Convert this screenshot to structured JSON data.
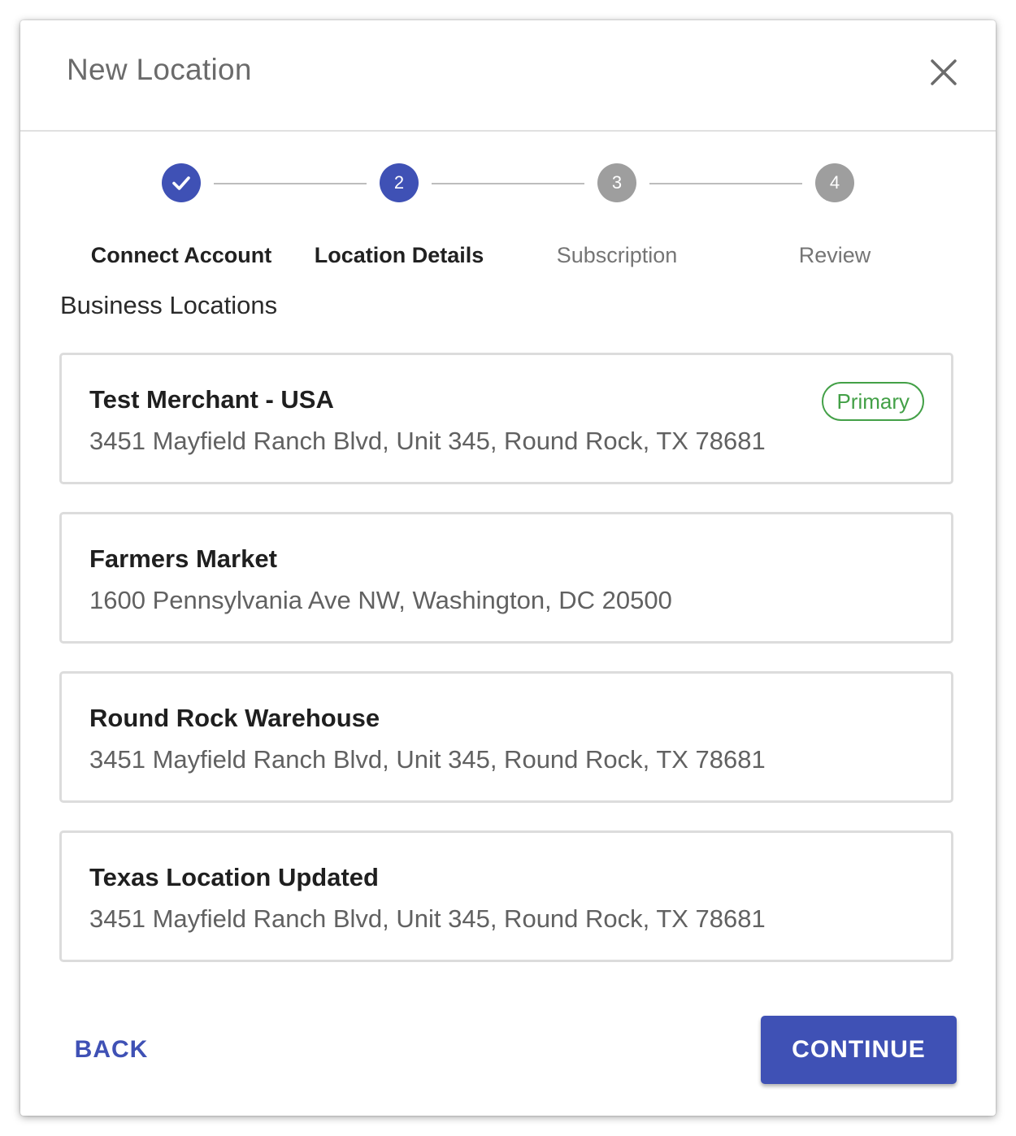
{
  "dialog": {
    "title": "New Location",
    "close_icon": "close-icon"
  },
  "stepper": {
    "steps": [
      {
        "number": "",
        "label": "Connect Account",
        "state": "completed",
        "icon": "check-icon"
      },
      {
        "number": "2",
        "label": "Location Details",
        "state": "active"
      },
      {
        "number": "3",
        "label": "Subscription",
        "state": "pending"
      },
      {
        "number": "4",
        "label": "Review",
        "state": "pending"
      }
    ]
  },
  "section_title": "Business Locations",
  "locations": [
    {
      "name": "Test Merchant - USA",
      "address": "3451 Mayfield Ranch Blvd, Unit 345, Round Rock, TX 78681",
      "badge": "Primary"
    },
    {
      "name": "Farmers Market",
      "address": "1600 Pennsylvania Ave NW, Washington, DC 20500"
    },
    {
      "name": "Round Rock Warehouse",
      "address": "3451 Mayfield Ranch Blvd, Unit 345, Round Rock, TX 78681"
    },
    {
      "name": "Texas Location Updated",
      "address": "3451 Mayfield Ranch Blvd, Unit 345, Round Rock, TX 78681"
    }
  ],
  "actions": {
    "back_label": "BACK",
    "continue_label": "CONTINUE"
  },
  "colors": {
    "primary": "#3f51b5",
    "inactive_step": "#9e9e9e",
    "primary_badge": "#43a047"
  }
}
